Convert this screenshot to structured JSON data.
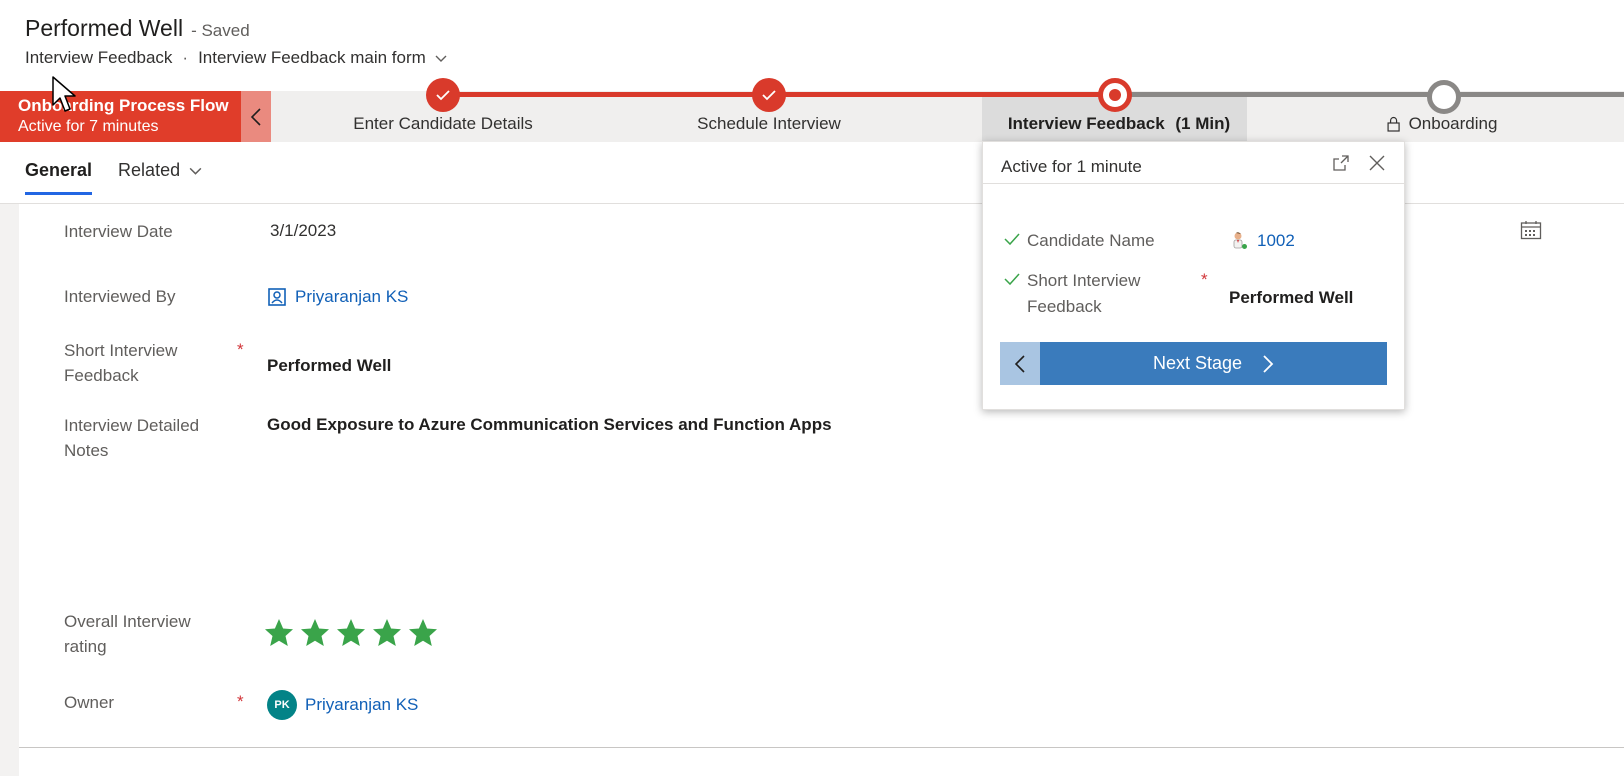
{
  "header": {
    "title": "Performed Well",
    "save_status": "- Saved",
    "entity": "Interview Feedback",
    "separator": "·",
    "form_name": "Interview Feedback main form"
  },
  "bpf": {
    "process_name": "Onboarding Process Flow",
    "active_for": "Active for 7 minutes",
    "stages": [
      {
        "label": "Enter Candidate Details",
        "status": "completed"
      },
      {
        "label": "Schedule Interview",
        "status": "completed"
      },
      {
        "label": "Interview Feedback",
        "duration": "(1 Min)",
        "status": "active"
      },
      {
        "label": "Onboarding",
        "status": "locked"
      }
    ],
    "colors": {
      "accent": "#d93a2b",
      "future": "#8a8886"
    }
  },
  "tabs": [
    {
      "label": "General",
      "selected": true
    },
    {
      "label": "Related",
      "selected": false
    }
  ],
  "form": {
    "interview_date": {
      "label": "Interview Date",
      "value": "3/1/2023"
    },
    "interviewed_by": {
      "label": "Interviewed By",
      "value": "Priyaranjan KS",
      "icon": "contact-card-icon"
    },
    "short_feedback": {
      "label": "Short Interview Feedback",
      "required": "*",
      "value": "Performed Well"
    },
    "detailed_notes": {
      "label": "Interview Detailed Notes",
      "value": "Good Exposure to Azure Communication Services and Function Apps"
    },
    "rating": {
      "label": "Overall Interview rating",
      "stars_filled": 5,
      "stars_total": 5,
      "color": "#3aa44a"
    },
    "owner": {
      "label": "Owner",
      "required": "*",
      "initials": "PK",
      "value": "Priyaranjan KS"
    }
  },
  "flyout": {
    "header": "Active for 1 minute",
    "fields": [
      {
        "label": "Candidate Name",
        "value": "1002",
        "icon": "candidate-person-icon"
      },
      {
        "label": "Short Interview Feedback",
        "required": "*",
        "value": "Performed Well"
      }
    ],
    "next_label": "Next Stage"
  },
  "icons": [
    "chevron-down-icon",
    "check-icon",
    "lock-icon",
    "calendar-icon",
    "expand-icon",
    "close-icon",
    "star-icon",
    "chevron-left-icon",
    "chevron-right-icon"
  ]
}
